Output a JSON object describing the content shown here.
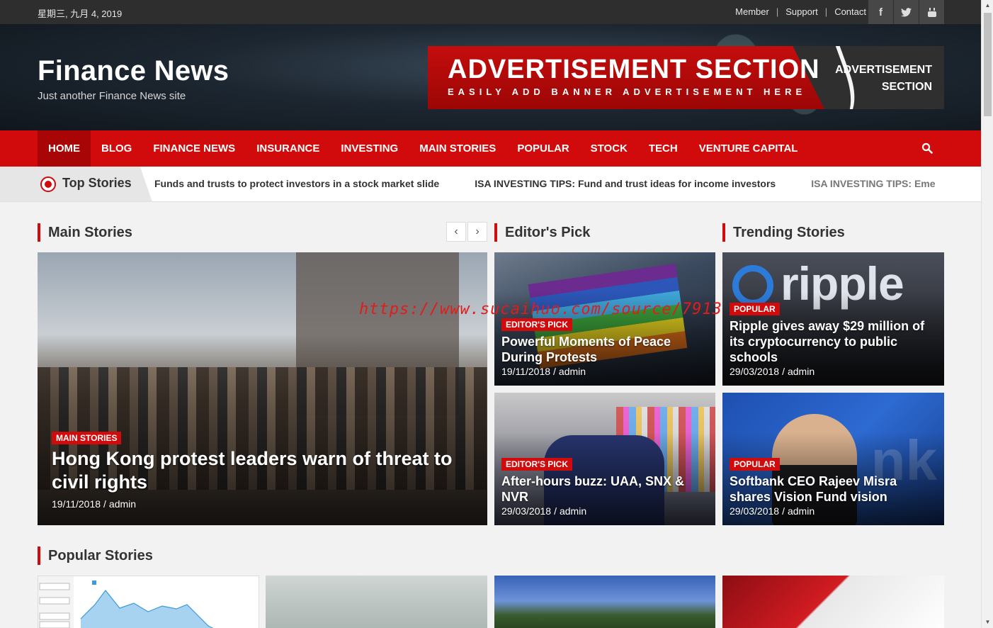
{
  "topbar": {
    "date": "星期三, 九月 4, 2019",
    "links": [
      "Member",
      "Support",
      "Contact"
    ],
    "social_icons": [
      "facebook-icon",
      "twitter-icon",
      "youtube-icon"
    ]
  },
  "header": {
    "site_title": "Finance News",
    "tagline": "Just another Finance News site",
    "ad": {
      "title": "ADVERTISEMENT SECTION",
      "subtitle": "EASILY ADD BANNER ADVERTISEMENT HERE",
      "right_line1": "ADVERTISEMENT",
      "right_line2": "SECTION"
    }
  },
  "nav": {
    "items": [
      "HOME",
      "BLOG",
      "FINANCE NEWS",
      "INSURANCE",
      "INVESTING",
      "MAIN STORIES",
      "POPULAR",
      "STOCK",
      "TECH",
      "VENTURE CAPITAL"
    ],
    "active": "HOME"
  },
  "ticker": {
    "label": "Top Stories",
    "items": [
      "Funds and trusts to protect investors in a stock market slide",
      "ISA INVESTING TIPS: Fund and trust ideas for income investors",
      "ISA INVESTING TIPS: Eme"
    ]
  },
  "sections": {
    "main": "Main Stories",
    "editors": "Editor's Pick",
    "trending": "Trending Stories",
    "popular": "Popular Stories"
  },
  "main_story": {
    "badge": "MAIN STORIES",
    "title_line1": "Hong Kong protest leaders warn of threat to",
    "title_line2": "civil rights",
    "date": "19/11/2018",
    "author": "admin"
  },
  "editors_pick": [
    {
      "badge": "EDITOR'S PICK",
      "title_line1": "Powerful Moments of Peace",
      "title_line2": "During Protests",
      "date": "19/11/2018",
      "author": "admin"
    },
    {
      "badge": "EDITOR'S PICK",
      "title_line1": "After-hours buzz: UAA, SNX &",
      "title_line2": "NVR",
      "date": "29/03/2018",
      "author": "admin"
    }
  ],
  "trending": [
    {
      "badge": "POPULAR",
      "title_line1": "Ripple gives away $29 million of",
      "title_line2": "its cryptocurrency to public",
      "title_line3": "schools",
      "date": "29/03/2018",
      "author": "admin",
      "image_text": "ripple"
    },
    {
      "badge": "POPULAR",
      "title_line1": "Softbank CEO Rajeev Misra",
      "title_line2": "shares Vision Fund vision",
      "date": "29/03/2018",
      "author": "admin"
    }
  ],
  "watermark": "https://www.sucaihuo.com/source/7913",
  "colors": {
    "accent": "#d10b0b",
    "topbar": "#2e2e2e"
  }
}
